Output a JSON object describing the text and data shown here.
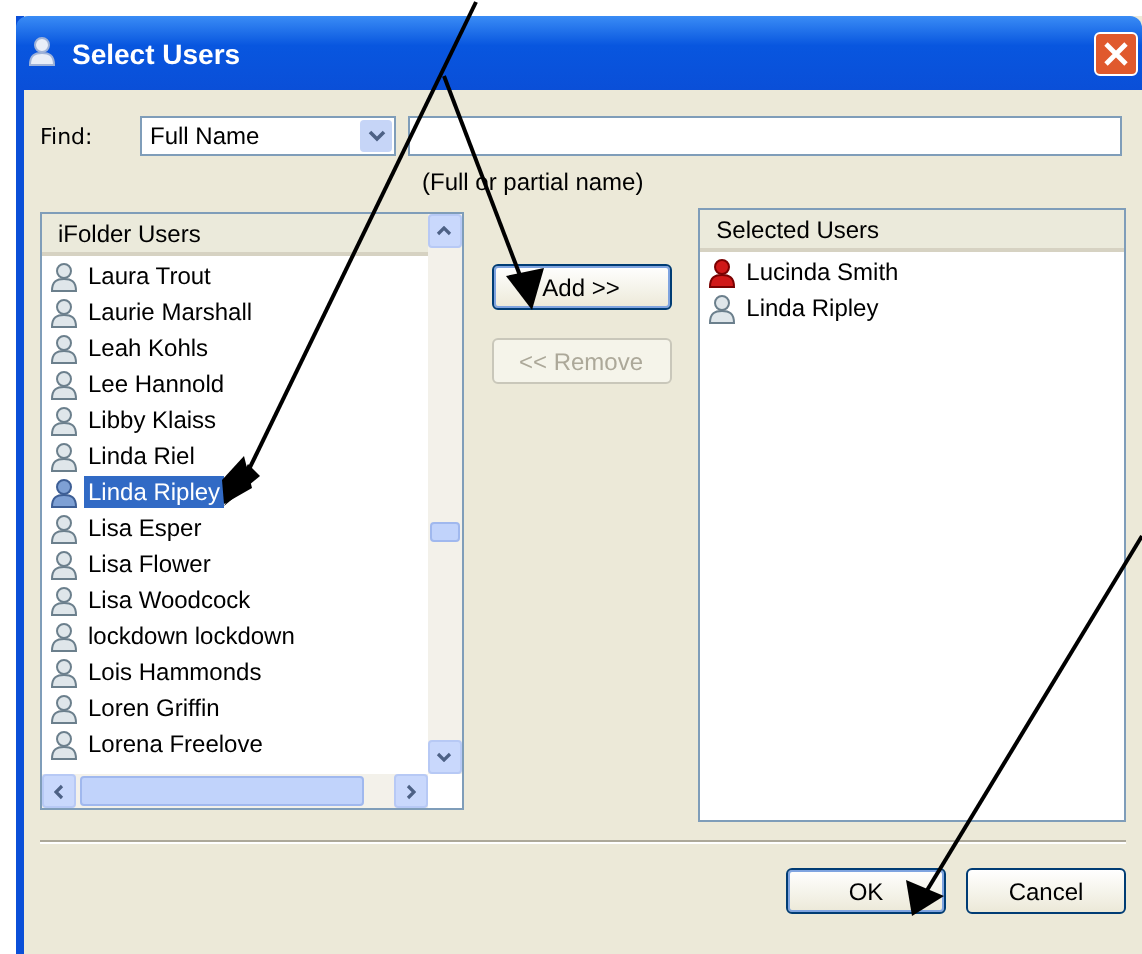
{
  "window": {
    "title": "Select Users"
  },
  "find": {
    "label": "Find:",
    "field": "Full Name",
    "hint": "(Full or partial name)"
  },
  "users_list": {
    "header": "iFolder Users",
    "items": [
      {
        "name": "Laura Trout",
        "selected": false
      },
      {
        "name": "Laurie Marshall",
        "selected": false
      },
      {
        "name": "Leah Kohls",
        "selected": false
      },
      {
        "name": "Lee Hannold",
        "selected": false
      },
      {
        "name": "Libby Klaiss",
        "selected": false
      },
      {
        "name": "Linda Riel",
        "selected": false
      },
      {
        "name": "Linda Ripley",
        "selected": true
      },
      {
        "name": "Lisa Esper",
        "selected": false
      },
      {
        "name": "Lisa Flower",
        "selected": false
      },
      {
        "name": "Lisa Woodcock",
        "selected": false
      },
      {
        "name": "lockdown lockdown",
        "selected": false
      },
      {
        "name": "Lois Hammonds",
        "selected": false
      },
      {
        "name": "Loren Griffin",
        "selected": false
      },
      {
        "name": "Lorena Freelove",
        "selected": false
      }
    ]
  },
  "move_buttons": [
    {
      "label": "Add >>",
      "disabled": false
    },
    {
      "label": "<< Remove",
      "disabled": true
    }
  ],
  "selected_list": {
    "header": "Selected Users",
    "items": [
      {
        "name": "Lucinda Smith",
        "kind": "owner"
      },
      {
        "name": "Linda Ripley",
        "kind": "member"
      }
    ]
  },
  "buttons": [
    {
      "label": "OK",
      "default": true
    },
    {
      "label": "Cancel",
      "default": false
    }
  ]
}
